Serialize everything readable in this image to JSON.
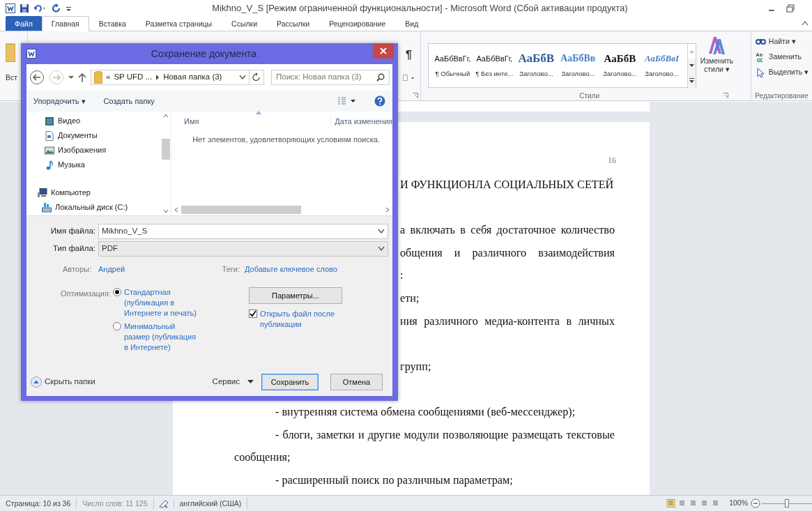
{
  "window": {
    "title": "Mikhno_V_S [Режим ограниченной функциональности] - Microsoft Word (Сбой активации продукта)"
  },
  "ribbon_tabs": [
    {
      "label": "Файл",
      "kind": "file",
      "selected": false
    },
    {
      "label": "Главная",
      "kind": "tab",
      "selected": true
    },
    {
      "label": "Вставка",
      "kind": "tab",
      "selected": false
    },
    {
      "label": "Разметка страницы",
      "kind": "tab",
      "selected": false
    },
    {
      "label": "Ссылки",
      "kind": "tab",
      "selected": false
    },
    {
      "label": "Рассылки",
      "kind": "tab",
      "selected": false
    },
    {
      "label": "Рецензирование",
      "kind": "tab",
      "selected": false
    },
    {
      "label": "Вид",
      "kind": "tab",
      "selected": false
    }
  ],
  "ribbon": {
    "paste_label": "Вст",
    "pilcrow": "¶",
    "styles": [
      {
        "sample": "АаБбВвГг,",
        "name": "¶ Обычный",
        "kind": "normal"
      },
      {
        "sample": "АаБбВвГг,",
        "name": "¶ Без инте...",
        "kind": "normal"
      },
      {
        "sample": "АаБбВ",
        "name": "Заголово...",
        "kind": "h1"
      },
      {
        "sample": "АаБбВв",
        "name": "Заголово...",
        "kind": "h2"
      },
      {
        "sample": "АаБбВ",
        "name": "Заголово...",
        "kind": "h3"
      },
      {
        "sample": "АаБбВвI",
        "name": "Заголово...",
        "kind": "h4"
      }
    ],
    "styles_group": "Стили",
    "change_styles": "Изменить стили ▾",
    "editing": [
      {
        "label": "Найти ▾",
        "kind": "find"
      },
      {
        "label": "Заменить",
        "kind": "replace"
      },
      {
        "label": "Выделить ▾",
        "kind": "select"
      }
    ],
    "editing_group": "Редактирование"
  },
  "dialog": {
    "title": "Сохранение документа",
    "breadcrumb": [
      "«",
      "SP UFD ...",
      "Новая папка (3)"
    ],
    "search": {
      "placeholder": "Поиск: Новая папка (3)"
    },
    "toolbar": [
      "Упорядочить ▾",
      "Создать папку"
    ],
    "nav": [
      {
        "label": "Видео",
        "kind": "video"
      },
      {
        "label": "Документы",
        "kind": "docs"
      },
      {
        "label": "Изображения",
        "kind": "images"
      },
      {
        "label": "Музыка",
        "kind": "music"
      },
      {
        "label": "Компьютер",
        "kind": "computer"
      },
      {
        "label": "Локальный диск (C:)",
        "kind": "disk"
      }
    ],
    "columns": [
      "Имя",
      "Дата изменения"
    ],
    "empty_message": "Нет элементов, удовлетворяющих условиям поиска.",
    "fields": [
      {
        "label": "Имя файла:",
        "value": "Mikhno_V_S"
      },
      {
        "label": "Тип файла:",
        "value": "PDF"
      }
    ],
    "authors_label": "Авторы:",
    "authors": "Андрей",
    "tags_label": "Теги:",
    "tags": "Добавьте ключевое слово",
    "optimization_label": "Оптимизация:",
    "optimization": [
      {
        "label": "Стандартная (публикация в Интернете и печать)",
        "selected": true
      },
      {
        "label": "Минимальный размер (публикация в Интернете)",
        "selected": false
      }
    ],
    "options_button": "Параметры...",
    "open_after": {
      "label": "Открыть файл после публикации",
      "checked": true
    },
    "hide_folders": "Скрыть папки",
    "tools": "Сервис",
    "buttons": [
      "Сохранить",
      "Отмена"
    ]
  },
  "document": {
    "page_number": "16",
    "blocks": [
      [
        {
          "text": "И ФУНКЦИОНЛА СОЦИАЛЬНЫХ СЕТЕЙ",
          "kind": "tail"
        }
      ],
      [
        {
          "text": "а включать в себя достаточное количество",
          "kind": "tail-justify"
        },
        {
          "text": "общения и различного взаимодействия",
          "kind": "tail-justify"
        },
        {
          "text": ":",
          "kind": "tail"
        },
        {
          "text": "ети;",
          "kind": "tail"
        },
        {
          "text": "ния различного медиа-контента в личных",
          "kind": "tail-justify"
        }
      ],
      [
        {
          "text": "групп;",
          "kind": "tail"
        }
      ],
      [
        {
          "text": "- внутренняя система обмена сообщениями (веб-мессенджер);",
          "kind": "indent"
        },
        {
          "text": "- блоги, заметки и другие модули позволяющие размещать текстовые",
          "kind": "indent-justify"
        },
        {
          "text": "сообщения;",
          "kind": "plain"
        },
        {
          "text": "- расширенный поиск по различным параметрам;",
          "kind": "indent"
        }
      ]
    ]
  },
  "status_bar": {
    "page": "Страница: 10 из 36",
    "words": "Число слов: 11 125",
    "language": "английский (США)",
    "zoom": "100%",
    "zoom_slider": {
      "level": 0.5
    }
  }
}
